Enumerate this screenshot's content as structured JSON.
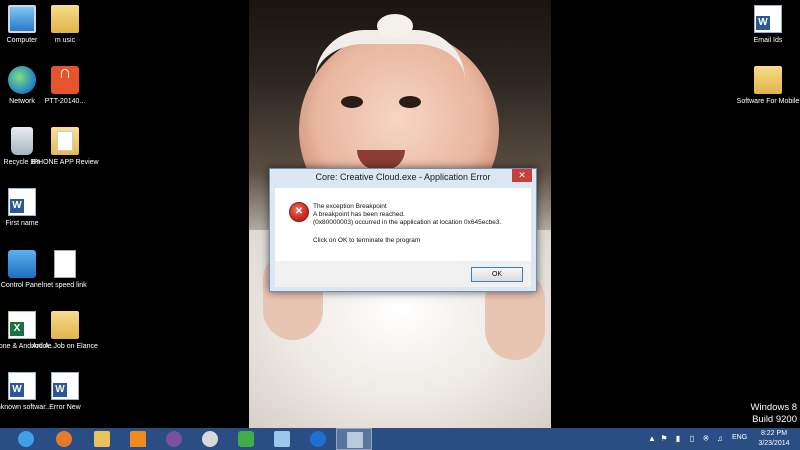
{
  "desktop": {
    "left_icons": [
      {
        "label": "Computer",
        "icon": "computer-icon"
      },
      {
        "label": "m usic",
        "icon": "folder-icon"
      },
      {
        "label": "Network",
        "icon": "network-icon"
      },
      {
        "label": "PTT-20140...",
        "icon": "audio-file-icon"
      },
      {
        "label": "Recycle Bin",
        "icon": "recycle-bin-icon"
      },
      {
        "label": "IPHONE APP Review",
        "icon": "document-folder-icon"
      },
      {
        "label": "First name",
        "icon": "word-document-icon"
      },
      {
        "label": "Control Panel",
        "icon": "control-panel-icon"
      },
      {
        "label": "net speed link",
        "icon": "text-file-icon"
      },
      {
        "label": "Iphone & Andriod A...",
        "icon": "excel-document-icon"
      },
      {
        "label": "Article Job on Elance",
        "icon": "folder-icon"
      },
      {
        "label": "unknown softwar...",
        "icon": "word-document-icon"
      },
      {
        "label": "Error New",
        "icon": "word-document-icon"
      }
    ],
    "right_icons": [
      {
        "label": "Email Ids",
        "icon": "word-document-icon"
      },
      {
        "label": "Software For Mobile",
        "icon": "folder-icon"
      }
    ],
    "watermark": {
      "line1": "Windows 8",
      "line2": "Build 9200"
    }
  },
  "dialog": {
    "title": "Core: Creative Cloud.exe - Application Error",
    "close_label": "✕",
    "message_line1": "The exception Breakpoint",
    "message_line2": "A breakpoint has been reached.",
    "message_line3": "(0x80000003) occurred in the application at location 0x645ecbe3.",
    "message_line4": "Click on OK to terminate the program",
    "ok_label": "OK"
  },
  "taskbar": {
    "pinned": [
      {
        "name": "internet-explorer-icon",
        "color": "#3fa0e8"
      },
      {
        "name": "firefox-icon",
        "color": "#e7792b"
      },
      {
        "name": "file-explorer-icon",
        "color": "#e8c35a"
      },
      {
        "name": "vlc-icon",
        "color": "#f08a1c"
      },
      {
        "name": "viber-icon",
        "color": "#7b519d"
      },
      {
        "name": "clock-app-icon",
        "color": "#d9d9d9"
      },
      {
        "name": "green-app-icon",
        "color": "#3fae49"
      },
      {
        "name": "paint-app-icon",
        "color": "#9bc7e8"
      },
      {
        "name": "teamviewer-icon",
        "color": "#1d6fd1"
      },
      {
        "name": "window-app-icon",
        "color": "#b7c9dc"
      }
    ],
    "language": "ENG",
    "time": "8:22 PM",
    "date": "3/23/2014"
  }
}
